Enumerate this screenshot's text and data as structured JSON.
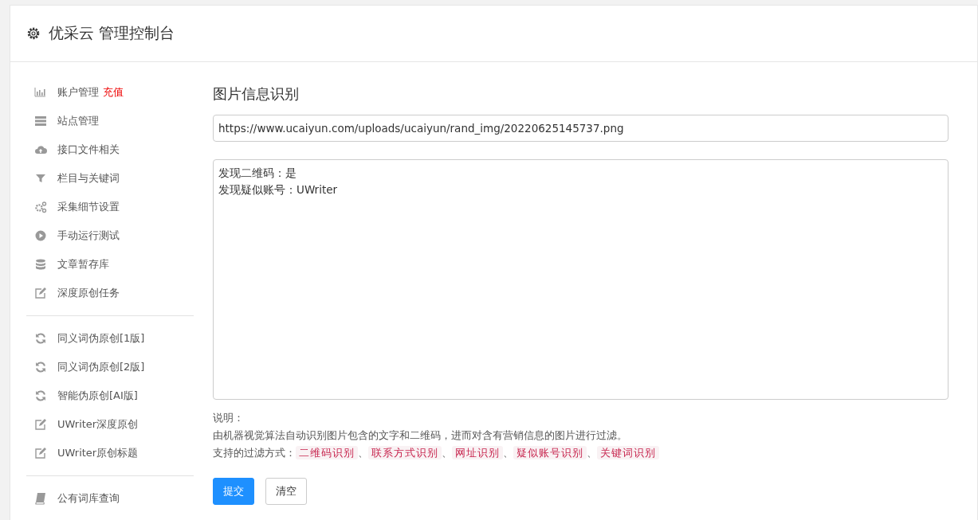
{
  "header": {
    "title": "优采云 管理控制台"
  },
  "sidebar": {
    "groups": [
      [
        {
          "label": "账户管理",
          "badge": "充值"
        },
        {
          "label": "站点管理"
        },
        {
          "label": "接口文件相关"
        },
        {
          "label": "栏目与关键词"
        },
        {
          "label": "采集细节设置"
        },
        {
          "label": "手动运行测试"
        },
        {
          "label": "文章暂存库"
        },
        {
          "label": "深度原创任务"
        }
      ],
      [
        {
          "label": "同义词伪原创[1版]"
        },
        {
          "label": "同义词伪原创[2版]"
        },
        {
          "label": "智能伪原创[AI版]"
        },
        {
          "label": "UWriter深度原创"
        },
        {
          "label": "UWriter原创标题"
        }
      ],
      [
        {
          "label": "公有词库查询"
        }
      ]
    ]
  },
  "main": {
    "title": "图片信息识别",
    "url_field": {
      "value": "https://www.ucaiyun.com/uploads/ucaiyun/rand_img/20220625145737.png"
    },
    "result_box": {
      "lines": [
        "发现二维码：是",
        "发现疑似账号：UWriter"
      ]
    },
    "notes": {
      "heading": "说明：",
      "description": "由机器视觉算法自动识别图片包含的文字和二维码，进而对含有营销信息的图片进行过滤。",
      "filter_label": "支持的过滤方式：",
      "tags": [
        {
          "text": "二维码识别",
          "separator": "、"
        },
        {
          "text": "联系方式识别",
          "separator": "、"
        },
        {
          "text": "网址识别",
          "separator": "、"
        },
        {
          "text": "疑似账号识别",
          "separator": "、"
        },
        {
          "text": "关键词识别"
        }
      ]
    },
    "buttons": [
      {
        "label": "提交",
        "kind": "primary"
      },
      {
        "label": "清空",
        "kind": "default"
      }
    ]
  }
}
